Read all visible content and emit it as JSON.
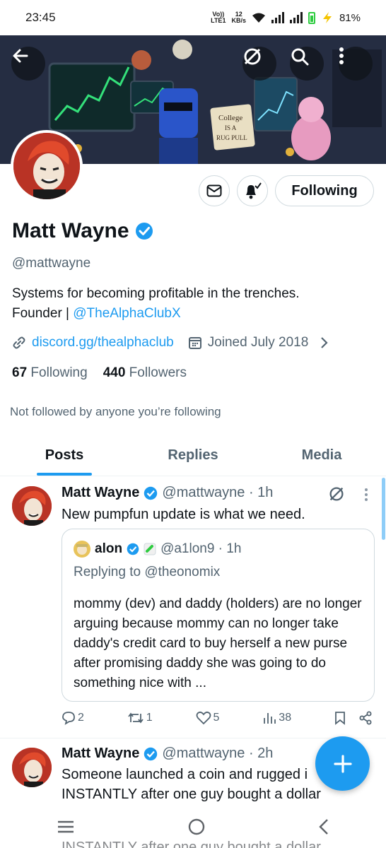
{
  "status": {
    "time": "23:45",
    "network_label_top": "Vo))",
    "network_label_bottom": "LTE1",
    "speed_value": "12",
    "speed_unit": "KB/s",
    "battery": "81%"
  },
  "banner": {
    "sign_text_1": "College",
    "sign_text_2": "IS A",
    "sign_text_3": "RUG PULL"
  },
  "profile": {
    "name": "Matt Wayne",
    "handle": "@mattwayne",
    "bio_line1": "Systems for becoming profitable in the trenches.",
    "bio_line2_prefix": "Founder | ",
    "bio_mention": "@TheAlphaClubX",
    "website": "discord.gg/thealphaclub",
    "joined": "Joined July 2018",
    "following_count": "67",
    "following_label": "Following",
    "followers_count": "440",
    "followers_label": "Followers",
    "not_followed": "Not followed by anyone you’re following",
    "follow_button": "Following"
  },
  "tabs": [
    {
      "label": "Posts"
    },
    {
      "label": "Replies"
    },
    {
      "label": "Media"
    }
  ],
  "tweets": [
    {
      "name": "Matt Wayne",
      "handle": "@mattwayne · 1h",
      "text": "New pumpfun update is what we need.",
      "quote": {
        "name": "alon",
        "handle": "@a1lon9 · 1h",
        "replying": "Replying to @theonomix",
        "body": "mommy (dev) and daddy (holders) are no longer arguing because mommy can no longer take daddy's credit card to buy herself a new purse after promising daddy she was going to do something nice with ..."
      },
      "replies": "2",
      "reposts": "1",
      "likes": "5",
      "views": "38"
    },
    {
      "name": "Matt Wayne",
      "handle": "@mattwayne · 2h",
      "text_line1": "Someone launched a coin and rugged i",
      "text_line2": "INSTANTLY after one guy bought a dollar",
      "ghost_line": "INSTANTLY after one guy bought a dollar"
    }
  ],
  "colors": {
    "accent": "#1d9bf0",
    "secondary_text": "#536471",
    "primary_text": "#0f1419"
  }
}
